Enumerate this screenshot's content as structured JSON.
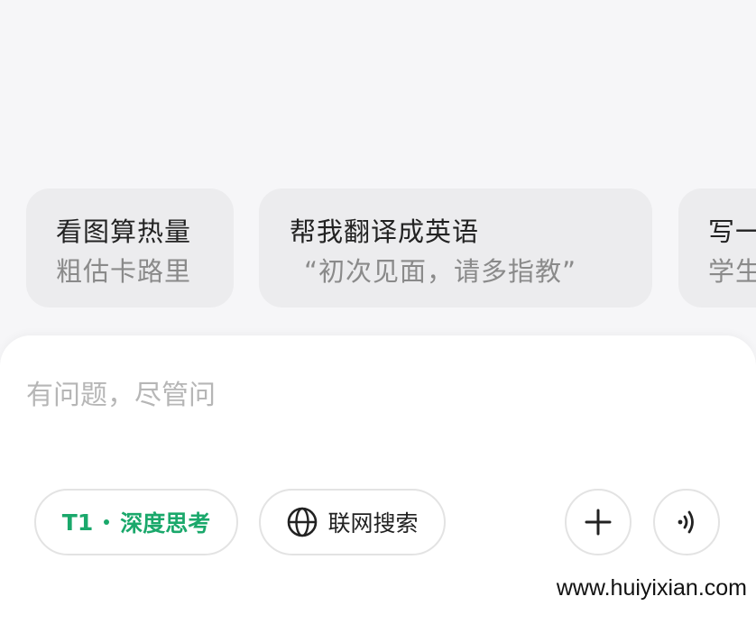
{
  "suggestions": [
    {
      "title": "看图算热量",
      "subtitle": "粗估卡路里"
    },
    {
      "title": "帮我翻译成英语",
      "subtitle": "“初次见面，请多指教”"
    },
    {
      "title": "写一",
      "subtitle": "学生"
    }
  ],
  "composer": {
    "placeholder": "有问题，尽管问",
    "think_model": "T1",
    "think_label": "深度思考",
    "search_label": "联网搜索",
    "add_icon": "plus-icon",
    "voice_icon": "voice-icon"
  },
  "watermark": "www.huiyixian.com",
  "colors": {
    "accent": "#1aa86b",
    "background": "#f6f6f8",
    "card": "#ececee"
  }
}
